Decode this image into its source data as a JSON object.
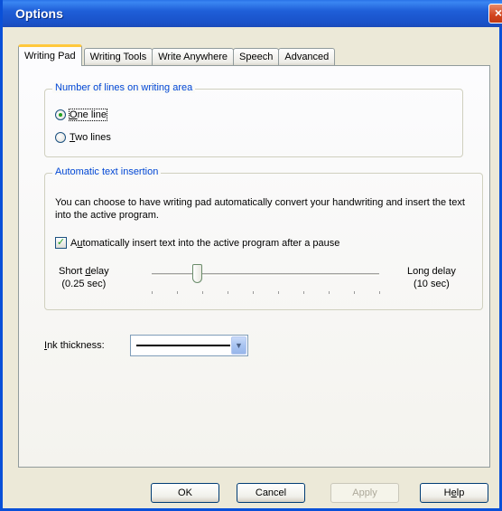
{
  "window": {
    "title": "Options",
    "close_glyph": "×"
  },
  "tabs": [
    {
      "label": "Writing Pad",
      "active": true
    },
    {
      "label": "Writing Tools",
      "active": false
    },
    {
      "label": "Write Anywhere",
      "active": false
    },
    {
      "label": "Speech",
      "active": false
    },
    {
      "label": "Advanced",
      "active": false
    }
  ],
  "lines_group": {
    "legend": "Number of lines on writing area",
    "one_line": {
      "accel": "O",
      "rest": "ne line",
      "checked": true
    },
    "two_lines": {
      "accel": "T",
      "rest": "wo lines",
      "checked": false
    }
  },
  "insertion_group": {
    "legend": "Automatic text insertion",
    "description": "You can choose to have writing pad automatically convert your handwriting and insert the text into the active program.",
    "checkbox": {
      "pre": "A",
      "accel": "u",
      "rest": "tomatically insert text into the active program after a pause",
      "checked": true
    },
    "short_label": {
      "pre": "Short ",
      "accel": "d",
      "rest": "elay",
      "line2": "(0.25 sec)"
    },
    "long_label": {
      "line1": "Long delay",
      "line2": "(10 sec)"
    },
    "slider_fraction": 0.2,
    "tick_count": 10
  },
  "ink": {
    "accel": "I",
    "rest": "nk thickness:"
  },
  "buttons": {
    "ok": "OK",
    "cancel": "Cancel",
    "apply": "Apply",
    "help_pre": "H",
    "help_accel": "e",
    "help_rest": "lp"
  },
  "colors": {
    "titlebar": "#1f5fd8",
    "legend_text": "#0046d5",
    "active_tab_accent": "#ffc83c",
    "check_mark": "#21a121"
  }
}
